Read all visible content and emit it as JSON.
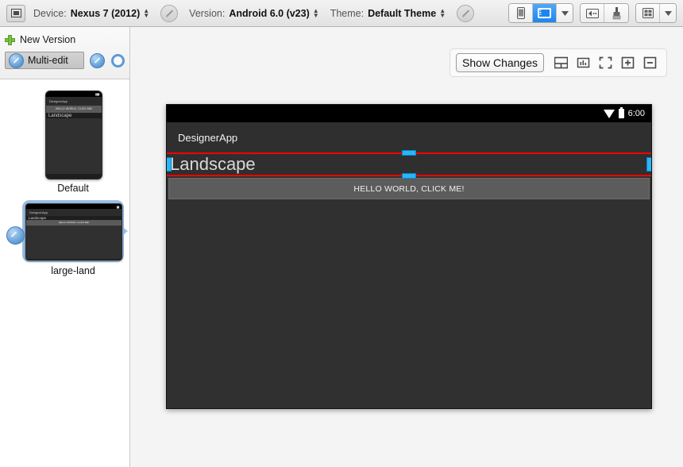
{
  "toolbar": {
    "device_icon": "device-preview-icon",
    "device_label": "Device:",
    "device_value": "Nexus 7 (2012)",
    "version_label": "Version:",
    "version_value": "Android 6.0 (v23)",
    "theme_label": "Theme:",
    "theme_value": "Default Theme",
    "edit_device_icon": "pencil-circle-icon",
    "edit_version_icon": "pencil-circle-icon",
    "edit_theme_icon": "pencil-circle-icon",
    "view_phone_icon": "phone-portrait-icon",
    "view_tablet_icon": "tablet-landscape-icon",
    "view_dropdown_icon": "chevron-down-icon",
    "back_nav_icon": "back-arrow-box-icon",
    "brush_icon": "paintbrush-icon",
    "grid_icon": "grid-layout-icon",
    "grid_dropdown_icon": "chevron-down-icon"
  },
  "sidebar": {
    "new_version_label": "New Version",
    "new_version_icon": "plus-icon",
    "multi_edit_label": "Multi-edit",
    "multi_edit_icon": "blue-pencil-icon",
    "edit_icon": "blue-pencil-icon",
    "circle_icon": "blue-ring-icon",
    "versions": [
      {
        "name": "Default",
        "selected": false,
        "preview": {
          "app_title": "DesignerApp",
          "button_label": "HELLO WORLD, CLICK ME!",
          "body_text": "Landscape",
          "orientation": "portrait"
        }
      },
      {
        "name": "large-land",
        "selected": true,
        "preview": {
          "app_title": "DesignerApp",
          "button_label": "HELLO WORLD, CLICK ME!",
          "body_text": "Landscape",
          "orientation": "landscape"
        }
      }
    ]
  },
  "preview_toolbar": {
    "show_changes_label": "Show Changes",
    "split_view_icon": "split-horizontal-icon",
    "stats_icon": "chart-box-icon",
    "fullscreen_icon": "fullscreen-icon",
    "zoom_in_icon": "zoom-in-icon",
    "zoom_out_icon": "zoom-out-icon"
  },
  "device_preview": {
    "status_time": "6:00",
    "wifi_icon": "wifi-icon",
    "battery_icon": "battery-icon",
    "app_title": "DesignerApp",
    "selected_text": "Landscape",
    "button_label": "HELLO WORLD, CLICK ME!",
    "selection_color": "#ff0000",
    "handle_color": "#29b6f6"
  }
}
